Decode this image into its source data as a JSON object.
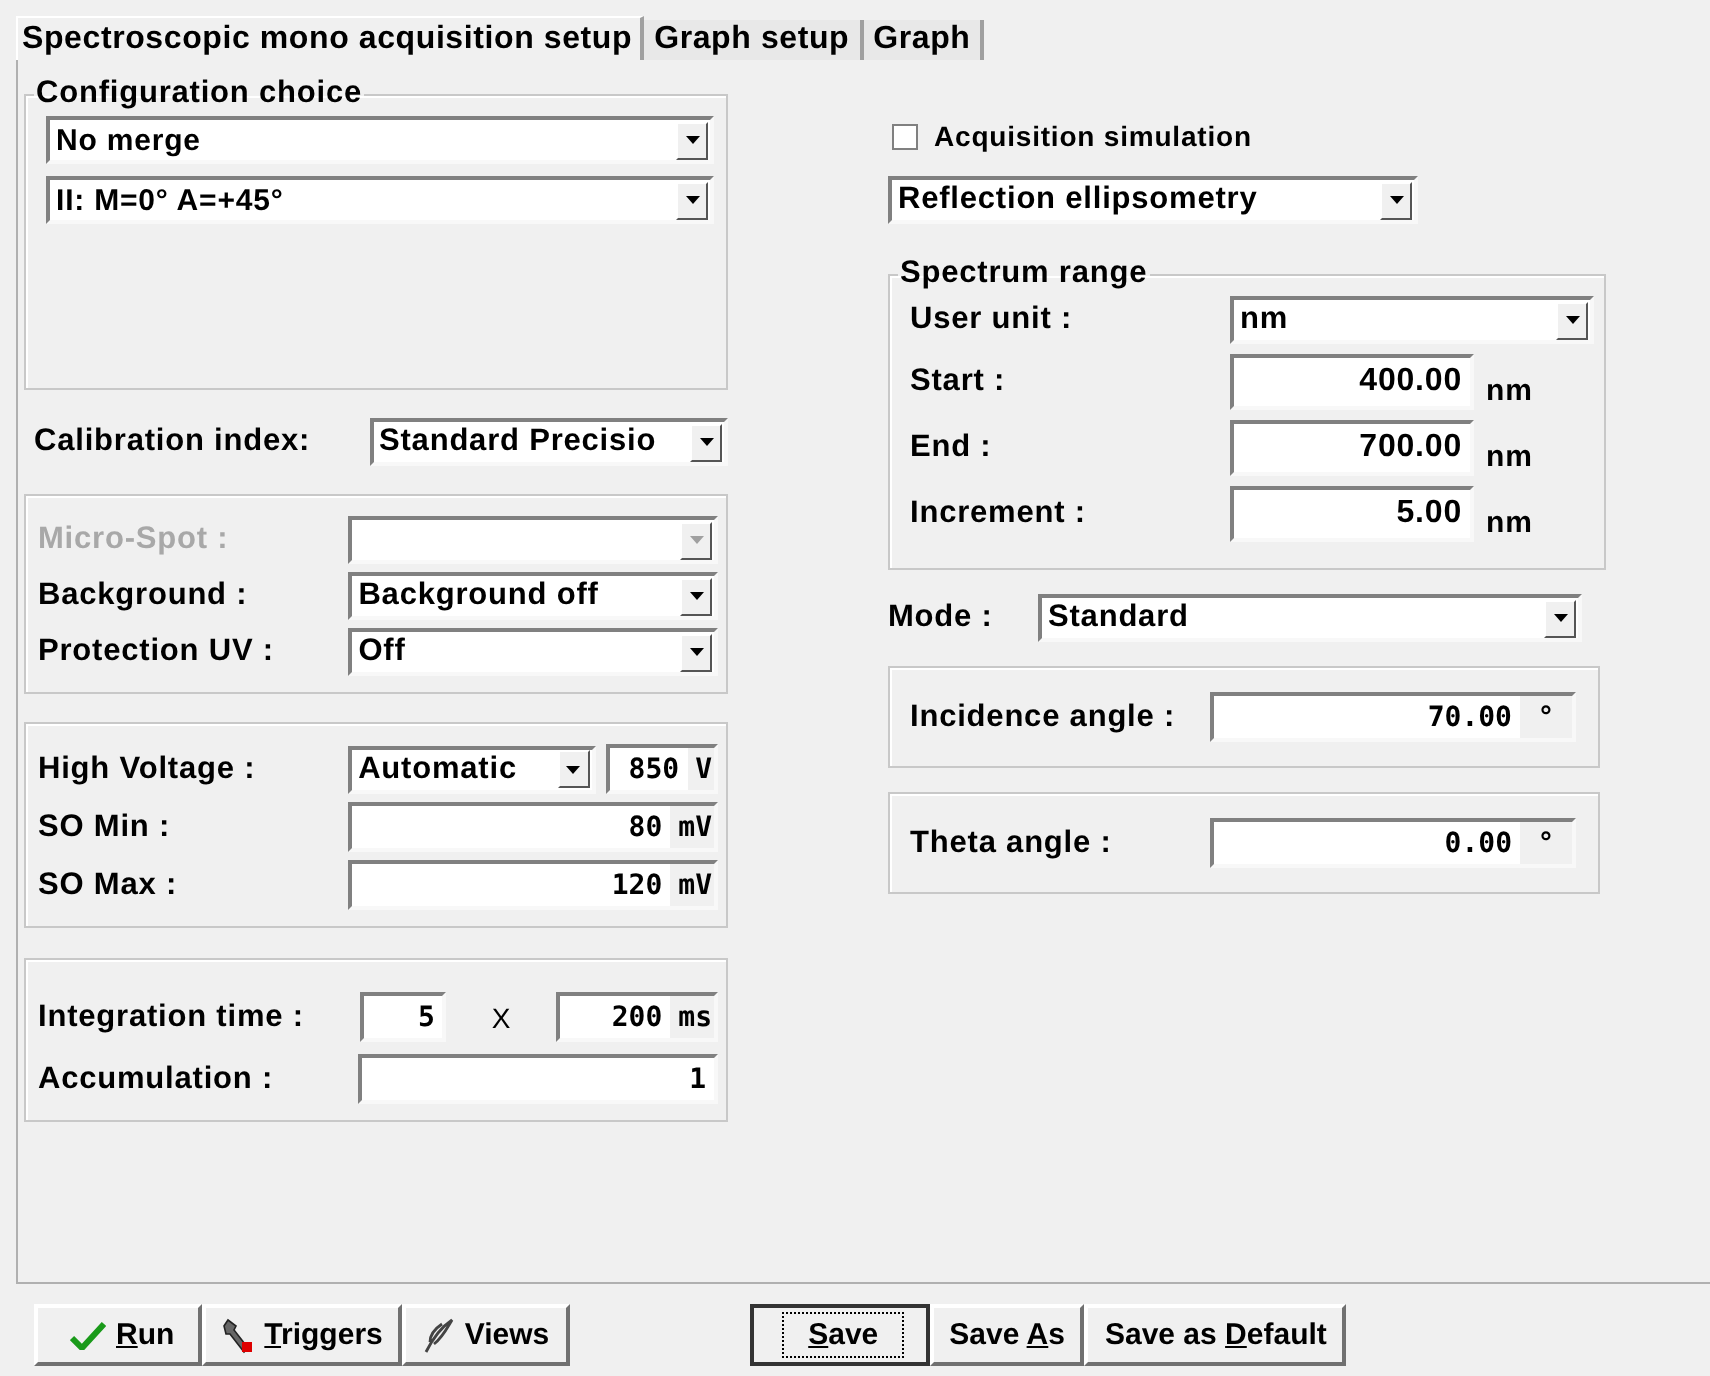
{
  "tabs": [
    {
      "label": "Spectroscopic mono acquisition setup",
      "selected": true
    },
    {
      "label": "Graph setup",
      "selected": false
    },
    {
      "label": "Graph",
      "selected": false
    }
  ],
  "configuration_choice": {
    "title": "Configuration choice",
    "dropdowns": [
      "No merge",
      "II:  M=0°   A=+45°"
    ]
  },
  "calibration_index": {
    "label": "Calibration index:",
    "value": "Standard Precisio"
  },
  "options": [
    {
      "label": "Micro-Spot :",
      "disabled": true
    },
    {
      "label": "Background :",
      "value": "Background off",
      "disabled": false
    },
    {
      "label": "Protection UV :",
      "value": "Off",
      "disabled": false
    }
  ],
  "detector": [
    {
      "kind": "dropdown_reading",
      "label": "High Voltage :",
      "value": "Automatic",
      "reading": "850",
      "unit": "V"
    },
    {
      "kind": "field",
      "label": "SO Min  :",
      "value": "80",
      "unit": "mV"
    },
    {
      "kind": "field",
      "label": "SO Max  :",
      "value": "120",
      "unit": "mV"
    }
  ],
  "integration": {
    "label": "Integration time :",
    "count": "5",
    "times": "X",
    "value": "200",
    "unit": "ms"
  },
  "accumulation": {
    "label": "Accumulation :",
    "value": "1"
  },
  "acquisition_simulation": {
    "label": "Acquisition simulation",
    "checked": false
  },
  "measurement_type": "Reflection ellipsometry",
  "spectrum_range": {
    "title": "Spectrum range",
    "unit_label": "User unit :",
    "unit_value": "nm",
    "rows": [
      {
        "label": "Start :",
        "value": "400.00",
        "unit": "nm"
      },
      {
        "label": "End :",
        "value": "700.00",
        "unit": "nm"
      },
      {
        "label": "Increment :",
        "value": "5.00",
        "unit": "nm"
      }
    ]
  },
  "mode": {
    "label": "Mode :",
    "value": "Standard"
  },
  "angles": [
    {
      "label": "Incidence angle :",
      "value": "70.00",
      "unit": "°"
    },
    {
      "label": "Theta angle :",
      "value": "0.00",
      "unit": "°"
    }
  ],
  "buttons_left": [
    {
      "access_key": "R",
      "label_after": "un"
    },
    {
      "access_key": "T",
      "label_after": "riggers"
    },
    {
      "label": "Views"
    }
  ],
  "buttons_right": [
    {
      "access_key": "S",
      "label_after": "ave",
      "focused": true
    },
    {
      "label_before": "Save ",
      "access_key": "A",
      "label_after": "s",
      "focused": false
    },
    {
      "label_before": "Save as ",
      "access_key": "D",
      "label_after": "efault",
      "focused": false
    }
  ]
}
